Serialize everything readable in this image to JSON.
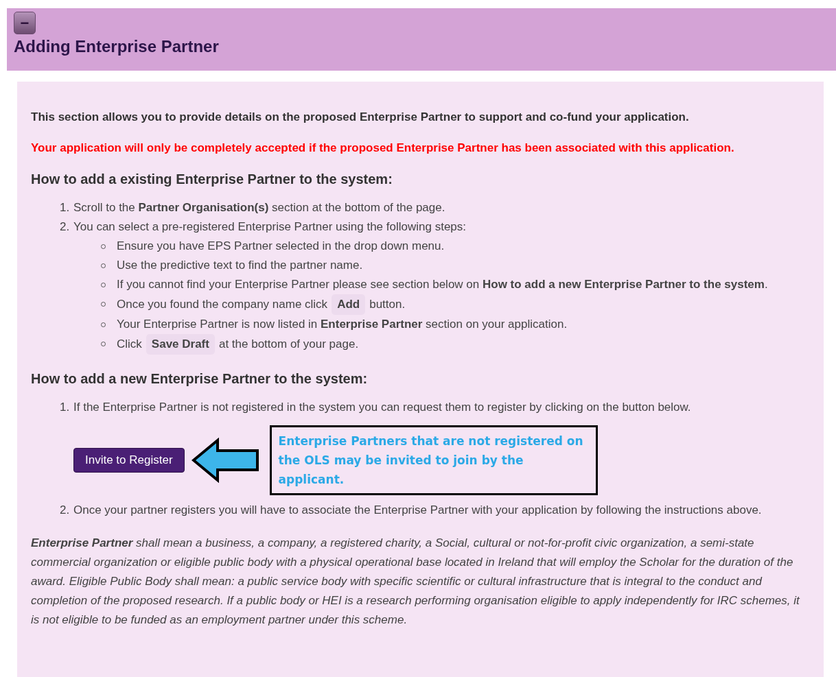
{
  "header": {
    "collapse_symbol": "−",
    "title": "Adding Enterprise Partner"
  },
  "intro": "This section allows you to provide details on the proposed Enterprise Partner to support and co-fund your application.",
  "warning": "Your application will only be completely accepted if the proposed Enterprise Partner has been associated with this application.",
  "sections": [
    {
      "heading": "How to add a existing Enterprise Partner to the system:",
      "steps": [
        {
          "number": "1.",
          "parts": [
            {
              "kind": "text",
              "text": "Scroll to the **Partner Organisation(s)** section at the bottom of the page."
            }
          ]
        },
        {
          "number": "2.",
          "parts": [
            {
              "kind": "text",
              "text": "You can select a pre-registered Enterprise Partner using the following steps:"
            }
          ],
          "bullets": [
            [
              {
                "kind": "text",
                "text": "Ensure you have EPS Partner selected in the drop down menu."
              }
            ],
            [
              {
                "kind": "text",
                "text": "Use the predictive text to find the partner name."
              }
            ],
            [
              {
                "kind": "text",
                "text": "If you cannot find your Enterprise Partner please see section below on **How to add a new Enterprise Partner to the system**."
              }
            ],
            [
              {
                "kind": "text",
                "text": "Once you found the company name click"
              },
              {
                "kind": "chip",
                "text": "Add"
              },
              {
                "kind": "text",
                "text": "button."
              }
            ],
            [
              {
                "kind": "text",
                "text": "Your Enterprise Partner is now listed in **Enterprise Partner** section on your application."
              }
            ],
            [
              {
                "kind": "text",
                "text": "Click"
              },
              {
                "kind": "chip",
                "text": "Save Draft"
              },
              {
                "kind": "text",
                "text": "at the bottom of your page."
              }
            ]
          ]
        }
      ]
    },
    {
      "heading": "How to add a new Enterprise Partner to the system:",
      "steps": [
        {
          "number": "1.",
          "parts": [
            {
              "kind": "text",
              "text": "If the Enterprise Partner is not registered in the system you can request them to register by clicking on the button below."
            }
          ],
          "action": {
            "button": "Invite to Register",
            "callout": "Enterprise Partners that are not registered on the OLS may be invited to join by the applicant."
          }
        },
        {
          "number": "2.",
          "parts": [
            {
              "kind": "text",
              "text": "Once your partner registers you will have to associate the Enterprise Partner with your application by following the instructions above."
            }
          ]
        }
      ]
    }
  ],
  "definition": "**Enterprise Partner** shall mean a business, a company, a registered charity, a Social, cultural or not-for-profit civic organization, a semi-state commercial organization or eligible public body with a physical operational base located in Ireland that will employ the Scholar for the duration of the award. Eligible Public Body shall mean: a public service body with specific scientific or cultural infrastructure that is integral to the conduct and completion of the proposed research. If a public body or HEI is a research performing organisation eligible to apply independently for IRC schemes, it is not eligible to be funded as an employment partner under this scheme."
}
